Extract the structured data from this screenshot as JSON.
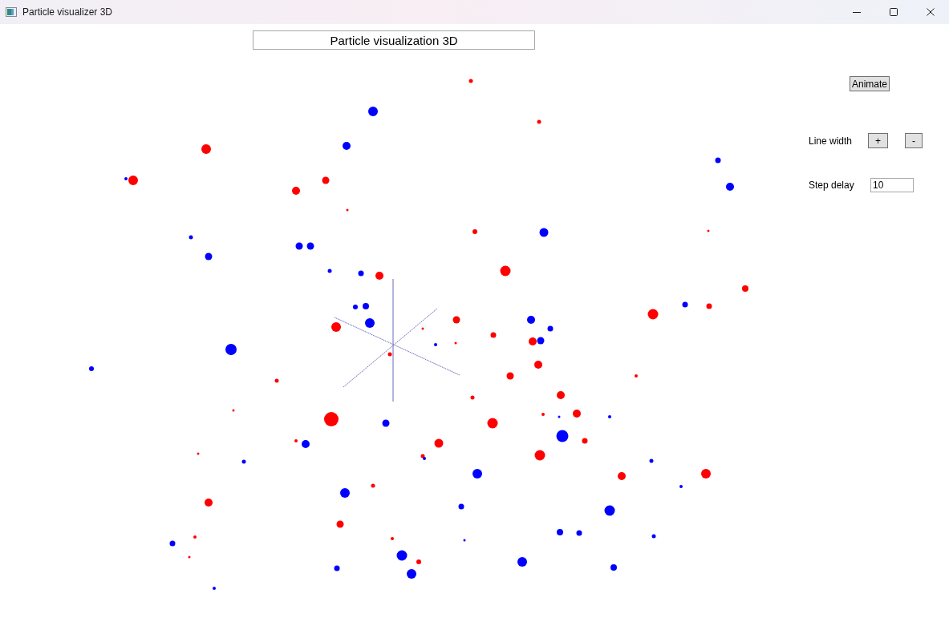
{
  "window": {
    "title": "Particle visualizer 3D"
  },
  "title_field": {
    "value": "Particle visualization 3D"
  },
  "animate_button": {
    "label": "Animate"
  },
  "line_width": {
    "label": "Line width",
    "buttons": [
      "+",
      "-"
    ]
  },
  "step_delay": {
    "label": "Step delay",
    "value": "10"
  }
}
